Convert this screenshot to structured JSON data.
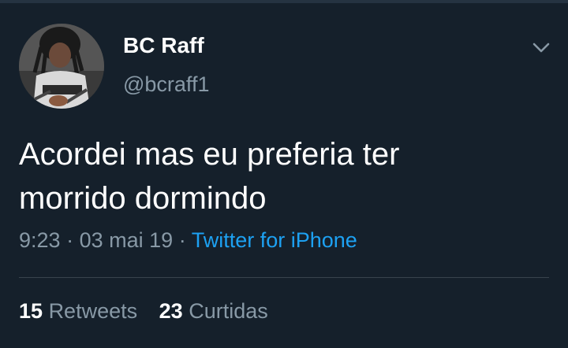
{
  "tweet": {
    "display_name": "BC Raff",
    "username": "@bcraff1",
    "text_line1": "Acordei mas eu preferia ter",
    "text_line2": "morrido dormindo",
    "time": "9:23",
    "date": "03 mai 19",
    "separator": "·",
    "source": "Twitter for iPhone",
    "retweets_count": "15",
    "retweets_label": "Retweets",
    "likes_count": "23",
    "likes_label": "Curtidas"
  },
  "icons": {
    "menu": "chevron-down-icon",
    "avatar": "profile-photo"
  },
  "colors": {
    "background": "#15202b",
    "primary_text": "#ffffff",
    "secondary_text": "#8899a6",
    "link": "#1da1f2",
    "divider": "#38444d"
  }
}
